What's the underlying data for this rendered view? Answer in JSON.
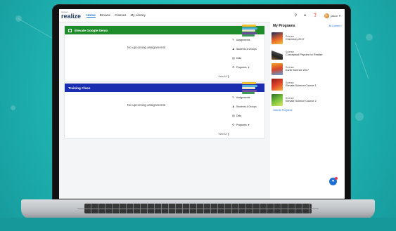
{
  "app": {
    "brand": "realize",
    "brand_sub": "savvas",
    "nav": [
      "Home",
      "Browse",
      "Classes",
      "My Library"
    ],
    "active_nav": "Home",
    "user_name": "jason"
  },
  "classes": [
    {
      "name": "Elevate Google Demo",
      "color": "#1e8c2b",
      "empty_text": "No upcoming assignments",
      "view_all": "View All",
      "links": [
        "Assignments",
        "Students & Groups",
        "Data",
        "Programs"
      ]
    },
    {
      "name": "Training Class",
      "color": "#1a2db0",
      "empty_text": "No upcoming assignments",
      "view_all": "View All",
      "links": [
        "Assignments",
        "Students & Groups",
        "Data",
        "Programs"
      ]
    }
  ],
  "programs": {
    "title": "My Programs",
    "all_content": "All Content",
    "items": [
      {
        "subject": "Science",
        "name": "Chemistry 2017"
      },
      {
        "subject": "Science",
        "name": "Conceptual Physics for Realize"
      },
      {
        "subject": "Science",
        "name": "Earth Science 2017"
      },
      {
        "subject": "Science",
        "name": "Elevate Science Course 1"
      },
      {
        "subject": "Science",
        "name": "Elevate Science Course 2"
      }
    ],
    "view_all": "View All Programs"
  }
}
